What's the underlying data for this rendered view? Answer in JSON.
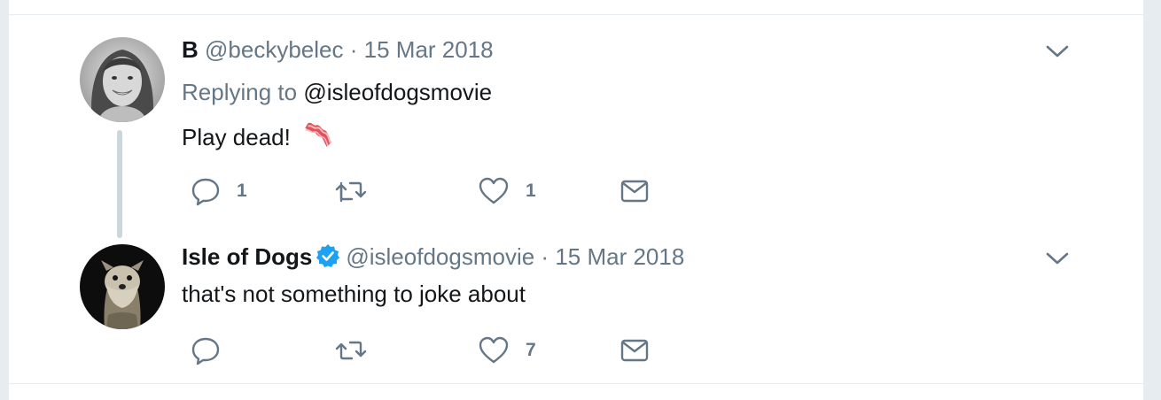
{
  "tweets": [
    {
      "name": "B",
      "handle": "@beckybelec",
      "separator": "·",
      "date": "15 Mar 2018",
      "replying_prefix": "Replying to",
      "replying_to": "@isleofdogsmovie",
      "text": "Play dead!",
      "emoji": "bacon",
      "reply_count": "1",
      "retweet_count": "",
      "like_count": "1"
    },
    {
      "name": "Isle of Dogs",
      "verified": true,
      "handle": "@isleofdogsmovie",
      "separator": "·",
      "date": "15 Mar 2018",
      "text": "that's not something to joke about",
      "reply_count": "",
      "retweet_count": "",
      "like_count": "7"
    }
  ],
  "colors": {
    "text_primary": "#14171a",
    "text_secondary": "#657786",
    "verified_blue": "#1da1f2",
    "thread_line": "#ccd6dd",
    "background": "#e6ecf0"
  },
  "icons": [
    "reply-icon",
    "retweet-icon",
    "like-icon",
    "direct-message-icon",
    "chevron-down-icon",
    "verified-badge-icon",
    "bacon-emoji"
  ]
}
